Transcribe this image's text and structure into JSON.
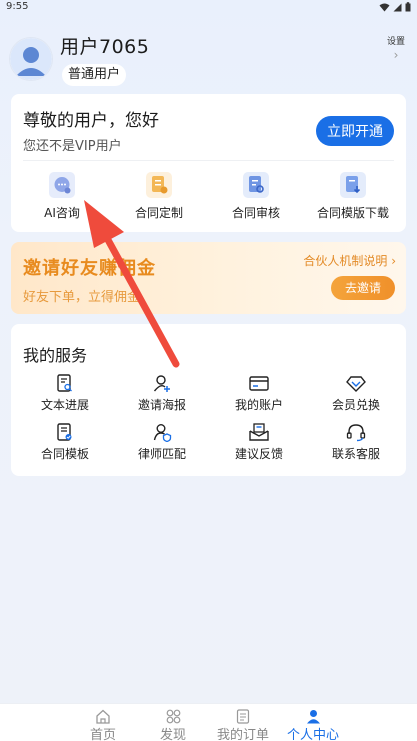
{
  "status_bar": {
    "time": "9:55"
  },
  "profile": {
    "name": "用户7065",
    "level": "普通用户",
    "settings_label": "设置"
  },
  "vip_card": {
    "greeting": "尊敬的用户，您好",
    "subtitle": "您还不是VIP用户",
    "button_label": "立即开通",
    "features": [
      {
        "label": "AI咨询",
        "icon": "chat-bubble-icon"
      },
      {
        "label": "合同定制",
        "icon": "contract-custom-icon"
      },
      {
        "label": "合同审核",
        "icon": "contract-review-icon"
      },
      {
        "label": "合同模版下载",
        "icon": "template-download-icon"
      }
    ]
  },
  "invite_banner": {
    "title": "邀请好友赚佣金",
    "subtitle": "好友下单，立得佣金",
    "link_label": "合伙人机制说明",
    "button_label": "去邀请"
  },
  "services": {
    "title": "我的服务",
    "items": [
      {
        "label": "文本进展",
        "icon": "document-search-icon"
      },
      {
        "label": "邀请海报",
        "icon": "add-user-icon"
      },
      {
        "label": "我的账户",
        "icon": "wallet-card-icon"
      },
      {
        "label": "会员兑换",
        "icon": "diamond-icon"
      },
      {
        "label": "合同模板",
        "icon": "contract-template-icon"
      },
      {
        "label": "律师匹配",
        "icon": "lawyer-match-icon"
      },
      {
        "label": "建议反馈",
        "icon": "feedback-envelope-icon"
      },
      {
        "label": "联系客服",
        "icon": "headset-icon"
      }
    ]
  },
  "bottom_nav": {
    "items": [
      {
        "label": "首页",
        "icon": "home-icon"
      },
      {
        "label": "发现",
        "icon": "grid-icon"
      },
      {
        "label": "我的订单",
        "icon": "order-list-icon"
      },
      {
        "label": "个人中心",
        "icon": "person-icon"
      }
    ],
    "active_index": 3
  },
  "colors": {
    "accent": "#1a6fe6",
    "invite_orange": "#e88b1f",
    "arrow_red": "#ef4b3c"
  }
}
